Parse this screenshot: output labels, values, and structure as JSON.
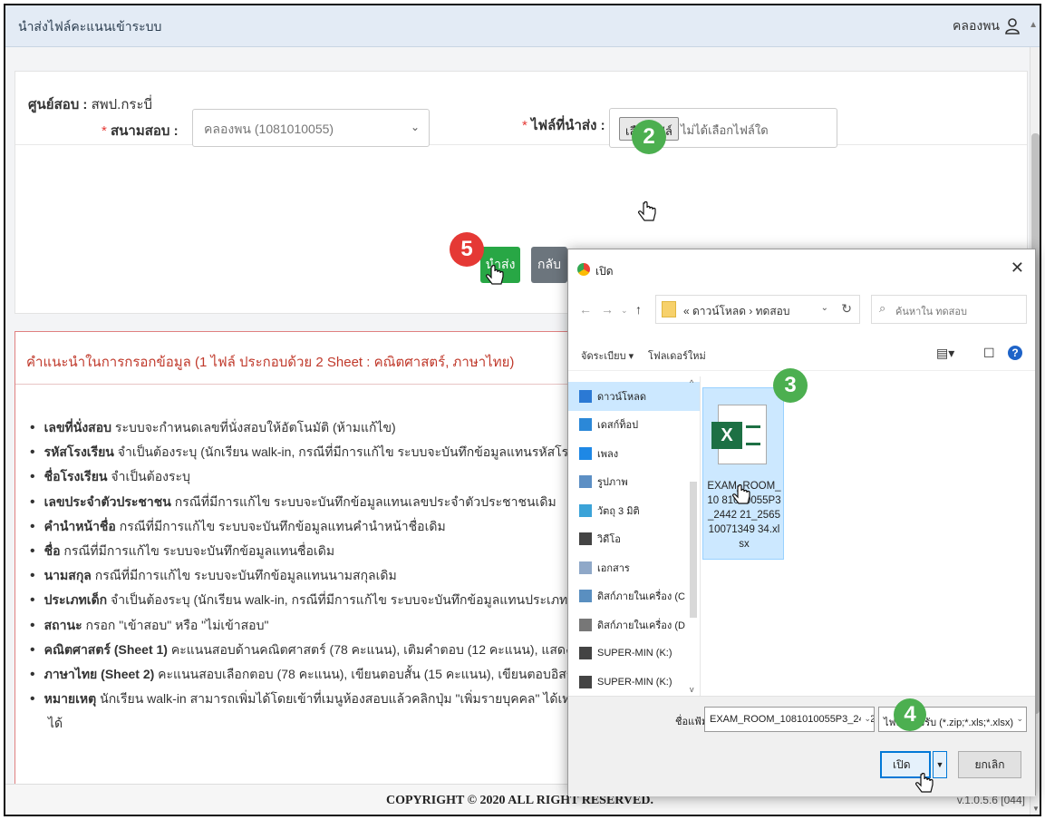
{
  "header": {
    "title": "นำส่งไฟล์คะแนนเข้าระบบ",
    "user": "คลองพน"
  },
  "center": {
    "label": "ศูนย์สอบ :",
    "value": "สพป.กระบี่"
  },
  "form": {
    "venue_label": "สนามสอบ :",
    "venue_value": "คลองพน (1081010055)",
    "file_label": "ไฟล์ที่นำส่ง :",
    "choose_file": "เลือกไฟล์",
    "no_file": "ไม่ได้เลือกไฟล์ใด",
    "submit": "นำส่ง",
    "back": "กลับ"
  },
  "steps": {
    "s2": "2",
    "s3": "3",
    "s4": "4",
    "s5": "5"
  },
  "guide": {
    "title": "คำแนะนำในการกรอกข้อมูล (1 ไฟล์ ประกอบด้วย 2 Sheet : คณิตศาสตร์, ภาษาไทย)",
    "items": [
      {
        "b": "เลขที่นั่งสอบ",
        "t": " ระบบจะกำหนดเลขที่นั่งสอบให้อัตโนมัติ (ห้ามแก้ไข)"
      },
      {
        "b": "รหัสโรงเรียน",
        "t": " จำเป็นต้องระบุ (นักเรียน walk-in, กรณีที่มีการแก้ไข ระบบจะบันทึกข้อมูลแทนรหัสโรงเรียน"
      },
      {
        "b": "ชื่อโรงเรียน",
        "t": " จำเป็นต้องระบุ"
      },
      {
        "b": "เลขประจำตัวประชาชน",
        "t": " กรณีที่มีการแก้ไข ระบบจะบันทึกข้อมูลแทนเลขประจำตัวประชาชนเดิม"
      },
      {
        "b": "คำนำหน้าชื่อ",
        "t": " กรณีที่มีการแก้ไข ระบบจะบันทึกข้อมูลแทนคำนำหน้าชื่อเดิม"
      },
      {
        "b": "ชื่อ",
        "t": " กรณีที่มีการแก้ไข ระบบจะบันทึกข้อมูลแทนชื่อเดิม"
      },
      {
        "b": "นามสกุล",
        "t": " กรณีที่มีการแก้ไข ระบบจะบันทึกข้อมูลแทนนามสกุลเดิม"
      },
      {
        "b": "ประเภทเด็ก",
        "t": " จำเป็นต้องระบุ (นักเรียน walk-in, กรณีที่มีการแก้ไข ระบบจะบันทึกข้อมูลแทนประเภทเด็ก"
      },
      {
        "b": "สถานะ",
        "t": " กรอก \"เข้าสอบ\" หรือ \"ไม่เข้าสอบ\""
      },
      {
        "b": "คณิตศาสตร์ (Sheet 1)",
        "t": " คะแนนสอบด้านคณิตศาสตร์ (78 คะแนน), เติมคำตอบ (12 คะแนน), แสดงวิธีท"
      },
      {
        "b": "ภาษาไทย (Sheet 2)",
        "t": " คะแนนสอบเลือกตอบ (78 คะแนน), เขียนตอบสั้น (15 คะแนน), เขียนตอบอิสระ (7"
      },
      {
        "b": "หมายเหตุ",
        "t": " นักเรียน walk-in สามารถเพิ่มได้โดยเข้าที่เมนูห้องสอบแล้วคลิกปุ่ม \"เพิ่มรายบุคคล\" ได้เท่านั้น"
      }
    ],
    "tail": "ได้"
  },
  "footer": {
    "copyright": "COPYRIGHT © 2020 ALL RIGHT RESERVED.",
    "version": "v.1.0.5.6 [044]"
  },
  "dialog": {
    "title": "เปิด",
    "path": "« ดาวน์โหลด › ทดสอบ",
    "search_placeholder": "ค้นหาใน ทดสอบ",
    "organize": "จัดระเบียบ ▾",
    "new_folder": "โฟลเดอร์ใหม่",
    "sidebar": [
      {
        "label": "ดาวน์โหลด",
        "icon": "download-icon",
        "color": "#2b79d4"
      },
      {
        "label": "เดสก์ท็อป",
        "icon": "desktop-icon",
        "color": "#2b88d8"
      },
      {
        "label": "เพลง",
        "icon": "music-icon",
        "color": "#1e88e5"
      },
      {
        "label": "รูปภาพ",
        "icon": "pictures-icon",
        "color": "#5c8fc4"
      },
      {
        "label": "วัตถุ 3 มิติ",
        "icon": "3d-objects-icon",
        "color": "#3ba3d8"
      },
      {
        "label": "วิดีโอ",
        "icon": "video-icon",
        "color": "#444444"
      },
      {
        "label": "เอกสาร",
        "icon": "documents-icon",
        "color": "#8fa8c8"
      },
      {
        "label": "ดิสก์ภายในเครื่อง (C",
        "icon": "drive-c-icon",
        "color": "#5a8fc0"
      },
      {
        "label": "ดิสก์ภายในเครื่อง (D",
        "icon": "drive-d-icon",
        "color": "#777777"
      },
      {
        "label": "SUPER-MIN (K:)",
        "icon": "usb-drive-icon",
        "color": "#444444"
      },
      {
        "label": "SUPER-MIN (K:)",
        "icon": "usb-drive-icon",
        "color": "#444444"
      }
    ],
    "file": {
      "name": "EXAM_ROOM_1081010055P3_244221_25651007134934.xlsx",
      "display": "EXAM_ROOM_10 81010055P3_2442 21_256510071349 34.xlsx"
    },
    "filename_label": "ชื่อแฟ้ม:",
    "filename_value": "EXAM_ROOM_1081010055P3_244221_",
    "filetype": "ไฟล์ที่รองรับ (*.zip;*.xls;*.xlsx)",
    "open": "เปิด",
    "cancel": "ยกเลิก"
  },
  "colors": {
    "submit_green": "#28a745",
    "back_gray": "#6c757d",
    "step_green": "#4caf50",
    "step_red": "#e53935",
    "guide_red": "#c0392b"
  }
}
